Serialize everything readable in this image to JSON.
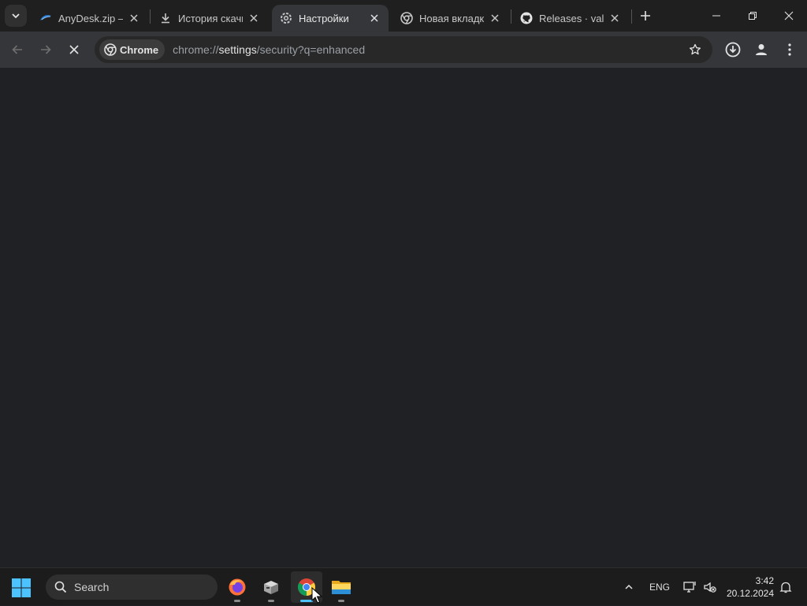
{
  "tabs": [
    {
      "title": "AnyDesk.zip —",
      "icon": "anydesk-icon",
      "active": false
    },
    {
      "title": "История скачи",
      "icon": "download-icon",
      "active": false
    },
    {
      "title": "Настройки",
      "icon": "settings-gear-icon",
      "active": true
    },
    {
      "title": "Новая вкладка",
      "icon": "chrome-icon",
      "active": false
    },
    {
      "title": "Releases · valin",
      "icon": "github-icon",
      "active": false
    }
  ],
  "omnibox": {
    "chip_label": "Chrome",
    "url_prefix": "chrome://",
    "url_host": "settings",
    "url_rest": "/security?q=enhanced"
  },
  "taskbar": {
    "search_placeholder": "Search",
    "apps": [
      "firefox-icon",
      "package-icon",
      "chrome-icon",
      "file-explorer-icon"
    ],
    "language": "ENG",
    "time": "3:42",
    "date": "20.12.2024"
  },
  "colors": {
    "tabstrip_bg": "#1f1f1f",
    "toolbar_bg": "#35363a",
    "content_bg": "#202124",
    "taskbar_bg": "#1c1c1c",
    "active_indicator": "#4cc2ff"
  }
}
